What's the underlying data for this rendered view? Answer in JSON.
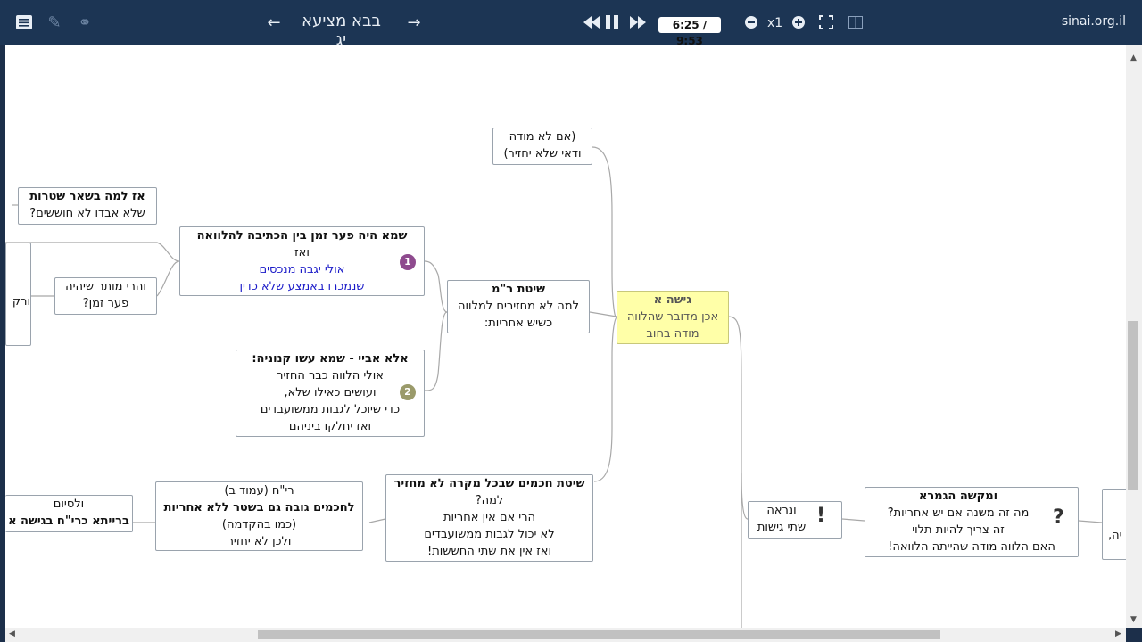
{
  "toolbar": {
    "title": "בבא מציעא יג",
    "time": "6:25 / 9:53",
    "speed": "x1",
    "site": "sinai.org.il"
  },
  "nodes": {
    "n_am_lo": {
      "line1": "(אם לא מודה",
      "line2": "ודאי שלא יחזיר)"
    },
    "n_az_lama": {
      "line1": "אז למה בשאר שטרות",
      "line2": "שלא אבדו לא חוששים?"
    },
    "n_shema": {
      "line1": "שמא היה פער זמן בין הכתיבה להלוואה",
      "line2": "ואז",
      "line3": "אולי יגבה מנכסים",
      "line4": "שנמכרו באמצע שלא כדין"
    },
    "n_ru": {
      "line1": "ורק"
    },
    "n_harei": {
      "line1": "והרי מותר שיהיה",
      "line2": "פער זמן?"
    },
    "n_shitat_rm": {
      "line1": "שיטת ר\"מ",
      "line2": "למה לא מחזירים למלווה",
      "line3": "כשיש אחריות:"
    },
    "n_gisha": {
      "line1": "גישה א",
      "line2": "אכן מדובר שהלווה",
      "line3": "מודה בחוב"
    },
    "n_ela_abaye": {
      "line1": "אלא אביי - שמא עשו קנוניה:",
      "line2": "אולי הלווה כבר החזיר",
      "line3": "ועושים כאילו שלא,",
      "line4": "כדי שיוכל לגבות ממשועבדים",
      "line5": "ואז יחלקו ביניהם"
    },
    "n_vesiyum": {
      "line1": "ולסיום",
      "line2": "ברייתא כרי\"ח בגישה א"
    },
    "n_rih": {
      "line1": "רי\"ח (עמוד ב)",
      "line2": "לחכמים גובה גם בשטר ללא אחריות",
      "line3": "(כמו בהקדמה)",
      "line4": "ולכן לא יחזיר"
    },
    "n_chachamim": {
      "line1": "שיטת חכמים שבכל מקרה לא מחזיר",
      "line2": "למה?",
      "line3": "הרי אם אין אחריות",
      "line4": "לא יכול לגבות ממשועבדים",
      "line5": "ואז אין את שתי החששות!"
    },
    "n_venir": {
      "line1": "ונראה",
      "line2": "שתי גישות"
    },
    "n_makshe": {
      "line1": "ומקשה הגמרא",
      "line2": "מה זה משנה אם יש אחריות?",
      "line3": "זה צריך להיות תלוי",
      "line4": "האם הלווה מודה שהייתה הלוואה!"
    },
    "n_edge": {
      "line1": "יה,"
    }
  },
  "badges": {
    "one": "1",
    "two": "2"
  },
  "marks": {
    "excl": "!",
    "quest": "?"
  },
  "colors": {
    "toolbar": "#1c3554",
    "highlight": "#ffffa8",
    "badge1": "#8e4a8e",
    "badge2": "#9a9a6a",
    "link": "#1a1ac8"
  }
}
